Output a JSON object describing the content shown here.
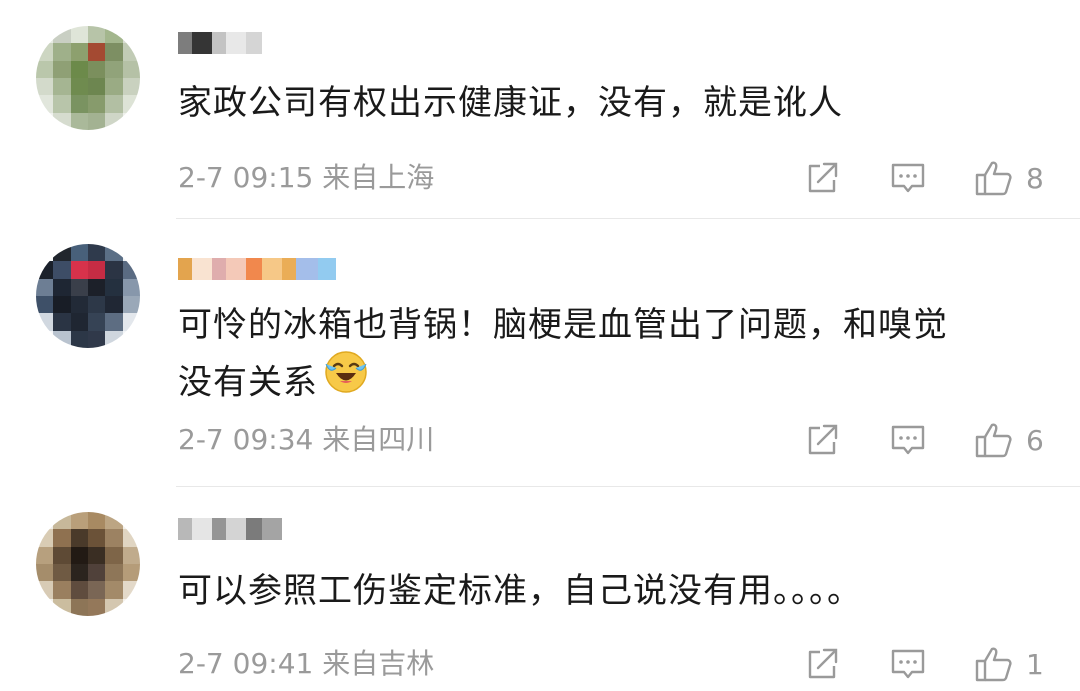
{
  "comments": [
    {
      "text_lines": [
        "家政公司有权出示健康证，没有，就是讹人"
      ],
      "time": "2-7 09:15",
      "location": "来自上海",
      "likes": "8",
      "avatar_colors": [
        "#e8ece4",
        "#c9cfc3",
        "#dfe5d8",
        "#b7c4a8",
        "#a3b68d",
        "#d8ddd2",
        "#cdd6c2",
        "#9fb08a",
        "#8da06e",
        "#a44a32",
        "#7d8f63",
        "#c1cbb5",
        "#bac7ab",
        "#8fa075",
        "#6c8a4a",
        "#7b8f5d",
        "#91a37a",
        "#b5c1a6",
        "#d3dacb",
        "#a5b592",
        "#6f8b4f",
        "#6d8650",
        "#9aab84",
        "#c9d1bf",
        "#e1e6dc",
        "#b8c5aa",
        "#7a9361",
        "#879b6c",
        "#b2bfa3",
        "#dde3d6",
        "#f0f2ee",
        "#d6dccf",
        "#aab99a",
        "#a3b292",
        "#cfd6c7",
        "#eef0eb"
      ],
      "name_colors": [
        "#6f6f6f",
        "#1f1f1f",
        "#bdbdbd",
        "#e6e6e6",
        "#d0d0d0"
      ]
    },
    {
      "text_lines": [
        "可怜的冰箱也背锅！脑梗是血管出了问题，和嗅觉",
        "没有关系"
      ],
      "time": "2-7 09:34",
      "location": "来自四川",
      "likes": "6",
      "avatar_colors": [
        "#f4f6f8",
        "#21262d",
        "#48607a",
        "#2f3a4c",
        "#5b6f86",
        "#eef1f4",
        "#1b212b",
        "#3d4d66",
        "#d7324b",
        "#c62c44",
        "#2b3444",
        "#5a6b82",
        "#6d7e94",
        "#1e2633",
        "#3a3f4a",
        "#1c2029",
        "#24303f",
        "#8797ab",
        "#3e5068",
        "#181d26",
        "#222a37",
        "#2d3848",
        "#202734",
        "#9aa8b8",
        "#d1d8e0",
        "#2a3444",
        "#1f2632",
        "#364355",
        "#5d6d82",
        "#e3e7ec",
        "#f6f7f9",
        "#b9c3cf",
        "#2c3747",
        "#30394a",
        "#cfd6de",
        "#f4f6f8"
      ],
      "name_colors": [
        "#e09a3b",
        "#f8e0cc",
        "#dca4a4",
        "#f3c3b0",
        "#f07b3a",
        "#f5c27a",
        "#e8a445",
        "#9ab7e8",
        "#86c5ee"
      ]
    },
    {
      "text_lines": [
        "可以参照工伤鉴定标准，自己说没有用。。。。"
      ],
      "time": "2-7 09:41",
      "location": "来自吉林",
      "likes": "1",
      "avatar_colors": [
        "#f2efe9",
        "#c7b89a",
        "#b99f7a",
        "#a88a62",
        "#bca583",
        "#f3f0ea",
        "#d9ccb4",
        "#8f7150",
        "#4a3a2a",
        "#6b5238",
        "#9c8262",
        "#e0d5c2",
        "#b7a07e",
        "#5e4a35",
        "#221a14",
        "#3a2e23",
        "#7e6548",
        "#c0ab8c",
        "#a58d6b",
        "#6f5a43",
        "#2b241e",
        "#50413a",
        "#8e7658",
        "#b59c79",
        "#d8cbb5",
        "#9a7f5f",
        "#5f4c3e",
        "#7a6655",
        "#a38a69",
        "#e3d9c9",
        "#f4f1ec",
        "#cbbd9f",
        "#8d7557",
        "#94785a",
        "#d4c7b0",
        "#f5f2ed"
      ],
      "name_colors": [
        "#b0b0b0",
        "#e2e2e2",
        "#8a8a8a",
        "#cfcfcf",
        "#6d6d6d",
        "#9a9a9a"
      ]
    }
  ],
  "icons": {
    "share": "share-icon",
    "reply": "comment-icon",
    "like": "thumbs-up-icon",
    "emoji": "laughing-tears-emoji-icon"
  },
  "colors": {
    "text": "#1a1a1a",
    "meta": "#9a9a9a",
    "divider": "#e8e8e8"
  }
}
